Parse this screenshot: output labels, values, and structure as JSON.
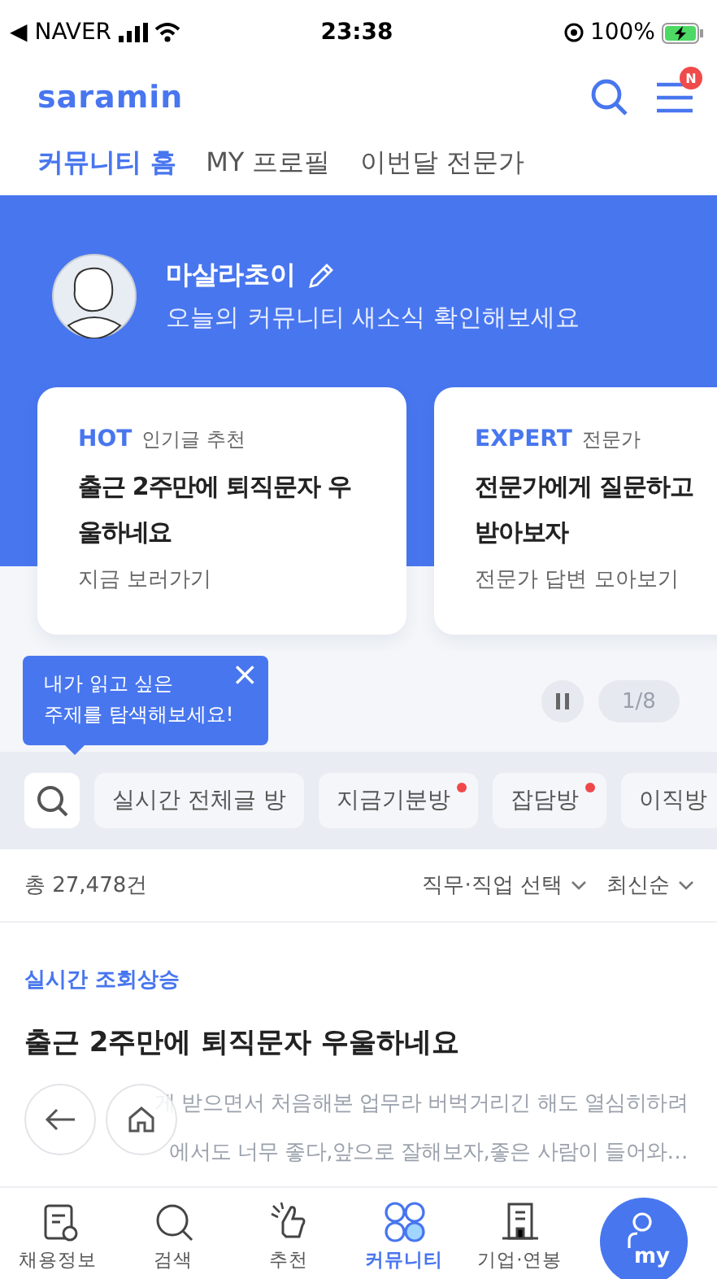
{
  "status_bar": {
    "back_app": "◀ NAVER",
    "time": "23:38",
    "battery": "100%"
  },
  "header": {
    "logo": "saramin",
    "menu_badge": "N"
  },
  "tabs": [
    {
      "label": "커뮤니티 홈",
      "selected": true
    },
    {
      "label": "MY 프로필",
      "selected": false
    },
    {
      "label": "이번달 전문가",
      "selected": false
    }
  ],
  "profile": {
    "name": "마살라초이",
    "subtitle": "오늘의 커뮤니티 새소식 확인해보세요"
  },
  "cards": [
    {
      "tag": "HOT",
      "category": "인기글 추천",
      "title_lines": [
        "출근 2주만에 퇴직문자 우",
        "울하네요"
      ],
      "link": "지금 보러가기"
    },
    {
      "tag": "EXPERT",
      "category": "전문가",
      "title_lines": [
        "전문가에게 질문하고",
        "받아보자"
      ],
      "link": "전문가 답변 모아보기"
    }
  ],
  "tooltip": {
    "lines": [
      "내가 읽고 싶은",
      "주제를 탐색해보세요!"
    ],
    "close": "×"
  },
  "pager": {
    "counter": "1/8"
  },
  "chips": [
    {
      "label": "실시간 전체글 방",
      "new": false
    },
    {
      "label": "지금기분방",
      "new": true
    },
    {
      "label": "잡담방",
      "new": true
    },
    {
      "label": "이직방",
      "new": false
    }
  ],
  "feed": {
    "total": "총 27,478건",
    "filters": [
      "직무·직업 선택",
      "최신순"
    ],
    "section": "실시간 조회상승",
    "post": {
      "title": "출근 2주만에 퇴직문자 우울하네요",
      "preview_lines": [
        "게 받으면서 처음해본 업무라 버벅거리긴 해도 열심히하려",
        "에서도 너무 좋다,앞으로 잘해보자,좋은 사람이 들어와…"
      ]
    }
  },
  "bottom_nav": [
    {
      "label": "채용정보",
      "selected": false
    },
    {
      "label": "검색",
      "selected": false
    },
    {
      "label": "추천",
      "selected": false
    },
    {
      "label": "커뮤니티",
      "selected": true
    },
    {
      "label": "기업·연봉",
      "selected": false
    }
  ],
  "my_button": {
    "label": "my"
  }
}
